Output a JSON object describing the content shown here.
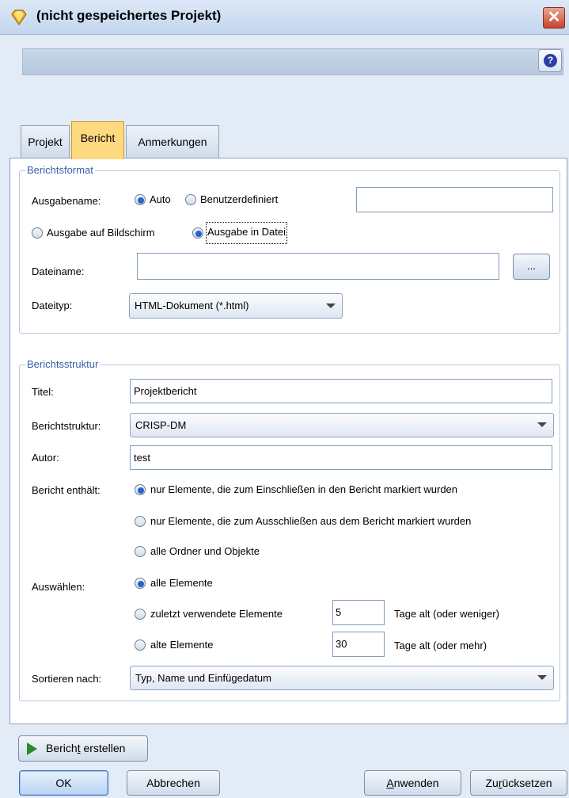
{
  "window": {
    "title": "(nicht gespeichertes Projekt)",
    "close_symbol": "✕",
    "help_symbol": "?"
  },
  "tabs": [
    {
      "label": "Projekt",
      "active": false
    },
    {
      "label": "Bericht",
      "active": true
    },
    {
      "label": "Anmerkungen",
      "active": false
    }
  ],
  "berichtsformat": {
    "legend": "Berichtsformat",
    "ausgabename_label": "Ausgabename:",
    "ausgabename_options": [
      {
        "label": "Auto",
        "selected": true
      },
      {
        "label": "Benutzerdefiniert",
        "selected": false
      }
    ],
    "custom_name_value": "",
    "output_options": [
      {
        "label": "Ausgabe auf Bildschirm",
        "selected": false
      },
      {
        "label": "Ausgabe in Datei",
        "selected": true
      }
    ],
    "dateiname_label": "Dateiname:",
    "dateiname_value": "",
    "browse_label": "...",
    "dateityp_label": "Dateityp:",
    "dateityp_value": "HTML-Dokument (*.html)"
  },
  "berichtsstruktur": {
    "legend": "Berichtsstruktur",
    "titel_label": "Titel:",
    "titel_value": "Projektbericht",
    "struktur_label": "Berichtstruktur:",
    "struktur_value": "CRISP-DM",
    "autor_label": "Autor:",
    "autor_value": "test",
    "enthaelt_label": "Bericht enthält:",
    "enthaelt_options": [
      {
        "label": "nur Elemente, die zum Einschließen in den Bericht markiert wurden",
        "selected": true
      },
      {
        "label": "nur Elemente, die zum Ausschließen aus dem Bericht markiert wurden",
        "selected": false
      },
      {
        "label": "alle Ordner und Objekte",
        "selected": false
      }
    ],
    "auswaehlen_label": "Auswählen:",
    "auswaehlen_options": [
      {
        "label": "alle Elemente",
        "selected": true
      },
      {
        "label": "zuletzt verwendete Elemente",
        "selected": false
      },
      {
        "label": "alte Elemente",
        "selected": false
      }
    ],
    "recent_days_value": "5",
    "recent_days_suffix": "Tage alt (oder weniger)",
    "old_days_value": "30",
    "old_days_suffix": "Tage alt (oder mehr)",
    "sortieren_label": "Sortieren nach:",
    "sortieren_value": "Typ, Name und Einfügedatum"
  },
  "buttons": {
    "create_pre": "Berich",
    "create_mnemonic": "t",
    "create_post": " erstellen",
    "ok": "OK",
    "abbrechen": "Abbrechen",
    "anwenden_mnemonic": "A",
    "anwenden_post": "nwenden",
    "zuruecksetzen_pre": "Zu",
    "zuruecksetzen_mnemonic": "r",
    "zuruecksetzen_post": "ücksetzen"
  },
  "colors": {
    "active_tab": "#ffd980",
    "legend_text": "#3b5dac",
    "radio_selected": "#2a62c9",
    "play_icon": "#2b8a2b"
  }
}
